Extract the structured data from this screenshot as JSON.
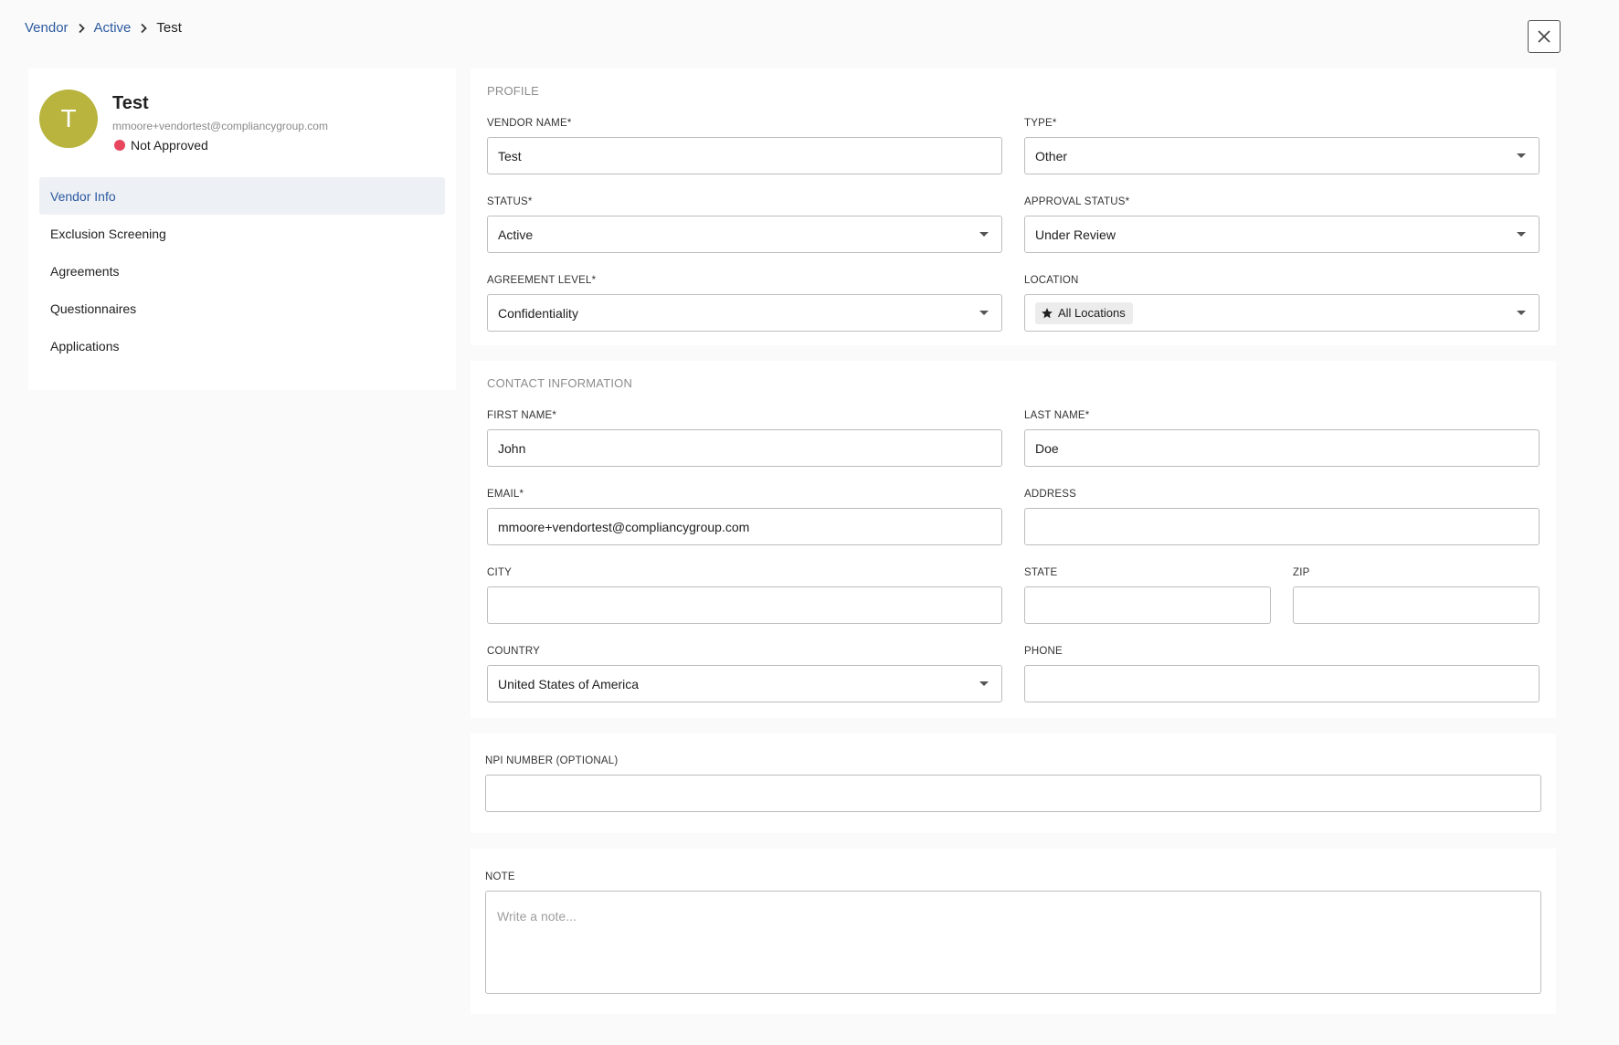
{
  "breadcrumb": {
    "items": [
      "Vendor",
      "Active"
    ],
    "current": "Test"
  },
  "sidebar": {
    "avatar_letter": "T",
    "vendor_name": "Test",
    "vendor_email": "mmoore+vendortest@compliancygroup.com",
    "approval_status": "Not Approved",
    "nav": [
      "Vendor Info",
      "Exclusion Screening",
      "Agreements",
      "Questionnaires",
      "Applications"
    ]
  },
  "profile": {
    "title": "PROFILE",
    "vendor_name": {
      "label": "VENDOR NAME*",
      "value": "Test"
    },
    "type": {
      "label": "TYPE*",
      "value": "Other"
    },
    "status": {
      "label": "STATUS*",
      "value": "Active"
    },
    "approval_status": {
      "label": "APPROVAL STATUS*",
      "value": "Under Review"
    },
    "agreement_level": {
      "label": "AGREEMENT LEVEL*",
      "value": "Confidentiality"
    },
    "location": {
      "label": "LOCATION",
      "chip": "All Locations"
    }
  },
  "contact": {
    "title": "CONTACT INFORMATION",
    "first_name": {
      "label": "FIRST NAME*",
      "value": "John"
    },
    "last_name": {
      "label": "LAST NAME*",
      "value": "Doe"
    },
    "email": {
      "label": "EMAIL*",
      "value": "mmoore+vendortest@compliancygroup.com"
    },
    "address": {
      "label": "ADDRESS",
      "value": ""
    },
    "city": {
      "label": "CITY",
      "value": ""
    },
    "state": {
      "label": "STATE",
      "value": ""
    },
    "zip": {
      "label": "ZIP",
      "value": ""
    },
    "country": {
      "label": "COUNTRY",
      "value": "United States of America"
    },
    "phone": {
      "label": "PHONE",
      "value": ""
    }
  },
  "npi": {
    "label": "NPI NUMBER (OPTIONAL)",
    "value": ""
  },
  "note": {
    "label": "NOTE",
    "placeholder": "Write a note..."
  },
  "colors": {
    "accent": "#2c5aa0",
    "avatar": "#b8b43e",
    "not_approved": "#e8455e",
    "active_nav_bg": "#edf0f5"
  },
  "icons": [
    "chevron-right-icon",
    "close-icon",
    "star-icon",
    "caret-down-icon"
  ]
}
